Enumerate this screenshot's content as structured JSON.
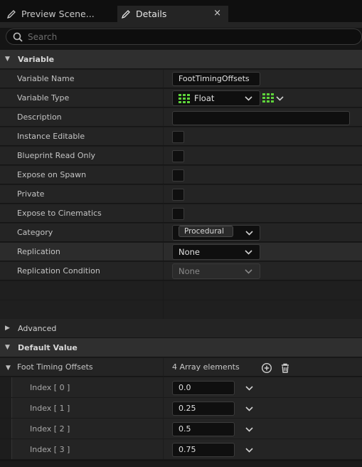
{
  "tabs": [
    {
      "label": "Preview Scene...",
      "icon": "pencil-icon"
    },
    {
      "label": "Details",
      "icon": "pencil-icon",
      "close": "×"
    }
  ],
  "search": {
    "placeholder": "Search"
  },
  "sections": {
    "variable": "Variable",
    "advanced": "Advanced",
    "default_value": "Default Value"
  },
  "properties": {
    "variable_name": {
      "label": "Variable Name",
      "value": "FootTimingOffsets"
    },
    "variable_type": {
      "label": "Variable Type",
      "value": "Float"
    },
    "description": {
      "label": "Description",
      "value": ""
    },
    "instance_editable": {
      "label": "Instance Editable"
    },
    "blueprint_read_only": {
      "label": "Blueprint Read Only"
    },
    "expose_on_spawn": {
      "label": "Expose on Spawn"
    },
    "private": {
      "label": "Private"
    },
    "expose_to_cinematics": {
      "label": "Expose to Cinematics"
    },
    "category": {
      "label": "Category",
      "value": "Procedural"
    },
    "replication": {
      "label": "Replication",
      "value": "None"
    },
    "replication_condition": {
      "label": "Replication Condition",
      "value": "None"
    }
  },
  "array": {
    "label": "Foot Timing Offsets",
    "count_text": "4 Array elements",
    "elements": [
      {
        "label": "Index [ 0 ]",
        "value": "0.0"
      },
      {
        "label": "Index [ 1 ]",
        "value": "0.25"
      },
      {
        "label": "Index [ 2 ]",
        "value": "0.5"
      },
      {
        "label": "Index [ 3 ]",
        "value": "0.75"
      }
    ]
  },
  "colors": {
    "float_pin": "#5ed43b",
    "accent": "#3a6fd8"
  }
}
